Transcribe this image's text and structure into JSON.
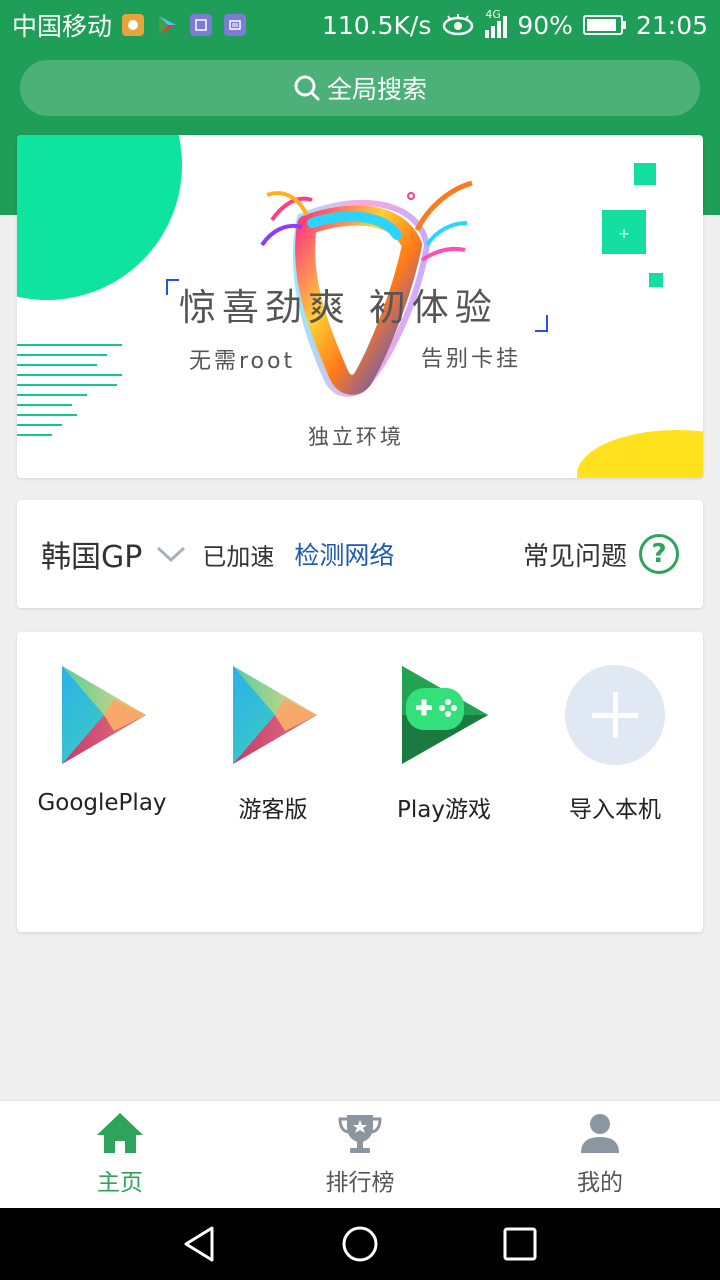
{
  "status_bar": {
    "carrier": "中国移动",
    "net_speed": "110.5K/s",
    "network_type": "4G",
    "battery": "90%",
    "time": "21:05"
  },
  "search": {
    "label": "全局搜索"
  },
  "banner": {
    "headline": "惊喜劲爽 初体验",
    "left_caption": "无需root",
    "right_caption": "告别卡挂",
    "bottom_caption": "独立环境"
  },
  "network": {
    "region": "韩国GP",
    "status": "已加速",
    "detect_link": "检测网络",
    "faq": "常见问题"
  },
  "apps": [
    {
      "label": "GooglePlay",
      "icon": "google-play-icon"
    },
    {
      "label": "游客版",
      "icon": "google-play-icon"
    },
    {
      "label": "Play游戏",
      "icon": "play-games-icon"
    },
    {
      "label": "导入本机",
      "icon": "add-icon"
    }
  ],
  "tabs": [
    {
      "label": "主页",
      "icon": "home-icon",
      "active": true
    },
    {
      "label": "排行榜",
      "icon": "trophy-icon",
      "active": false
    },
    {
      "label": "我的",
      "icon": "person-icon",
      "active": false
    }
  ],
  "colors": {
    "primary_green": "#1e9e57",
    "active_tab": "#2ea35c",
    "inactive_tab": "#8c96a0",
    "link_blue": "#1b57b5"
  }
}
